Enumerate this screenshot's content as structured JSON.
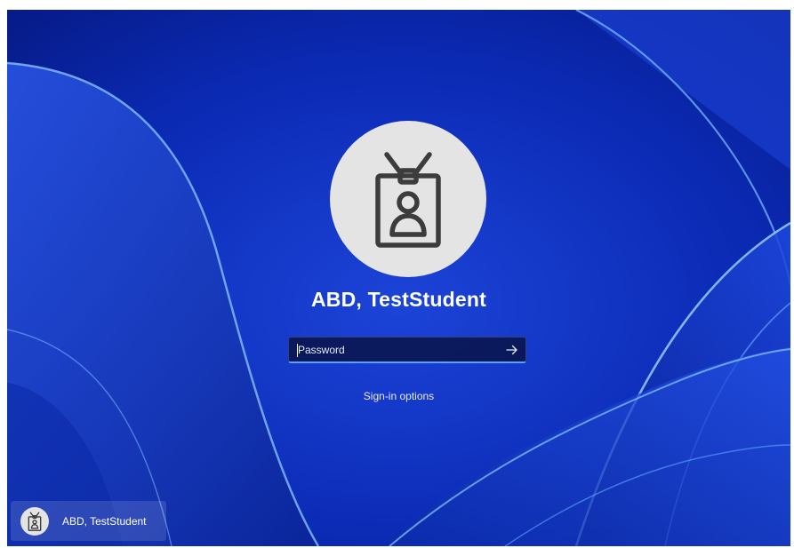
{
  "user": {
    "display_name": "ABD, TestStudent"
  },
  "password": {
    "placeholder": "Password",
    "value": ""
  },
  "signin_options": {
    "label": "Sign-in options"
  },
  "user_switcher": {
    "tile_name": "ABD, TestStudent"
  },
  "icons": {
    "avatar": "id-badge-icon",
    "submit": "arrow-right-icon"
  },
  "colors": {
    "background": "#0a2ab0",
    "avatar_bg": "#e4e4e4",
    "icon": "#3c3c3c",
    "input_focus": "#5aa0ff"
  }
}
